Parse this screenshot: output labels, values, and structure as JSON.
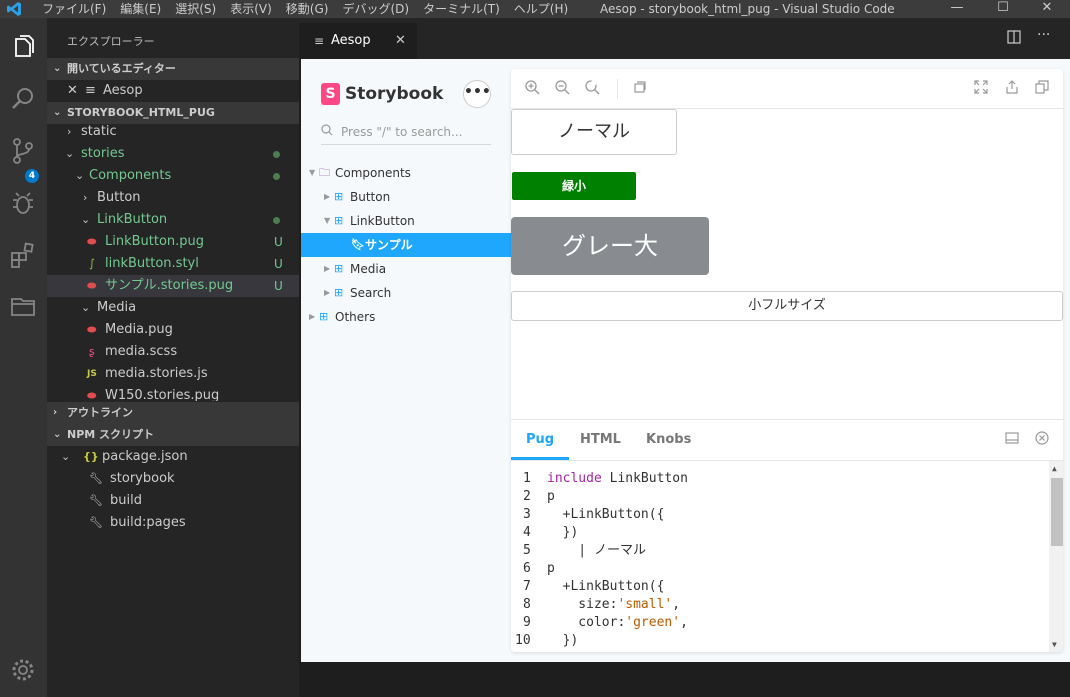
{
  "titlebar": {
    "menus": [
      "ファイル(F)",
      "編集(E)",
      "選択(S)",
      "表示(V)",
      "移動(G)",
      "デバッグ(D)",
      "ターミナル(T)",
      "ヘルプ(H)"
    ],
    "title": "Aesop - storybook_html_pug - Visual Studio Code",
    "minimize": "—",
    "maximize": "☐",
    "close": "✕"
  },
  "activity": {
    "icons": [
      "explorer-icon",
      "search-icon",
      "source-control-icon",
      "debug-icon",
      "extensions-icon",
      "remote-explorer-icon",
      "settings-gear-icon"
    ],
    "scm_badge": "4"
  },
  "sidebar": {
    "title": "エクスプローラー",
    "open_editors": {
      "header": "開いているエディター",
      "items": [
        {
          "close": "✕",
          "icon": "≡",
          "label": "Aesop"
        }
      ]
    },
    "project": {
      "header": "STORYBOOK_HTML_PUG",
      "tree": [
        {
          "arrow": "›",
          "label": "static"
        },
        {
          "arrow": "⌄",
          "label": "stories"
        },
        {
          "arrow": "⌄",
          "label": "Components"
        },
        {
          "arrow": "›",
          "label": "Button"
        },
        {
          "arrow": "⌄",
          "label": "LinkButton"
        },
        {
          "icon": "pug",
          "label": "LinkButton.pug",
          "status": "U"
        },
        {
          "icon": "styl",
          "label": "linkButton.styl",
          "status": "U"
        },
        {
          "icon": "pug",
          "label": "サンプル.stories.pug",
          "status": "U"
        },
        {
          "arrow": "⌄",
          "label": "Media"
        },
        {
          "icon": "pug",
          "label": "Media.pug"
        },
        {
          "icon": "scss",
          "label": "media.scss"
        },
        {
          "icon": "JS",
          "label": "media.stories.js"
        },
        {
          "icon": "pug",
          "label": "W150.stories.pug"
        }
      ]
    },
    "outline": {
      "header": "アウトライン"
    },
    "npm": {
      "header": "NPM スクリプト",
      "package": "package.json",
      "scripts": [
        "storybook",
        "build",
        "build:pages"
      ]
    }
  },
  "editor": {
    "tab": {
      "icon": "≡",
      "label": "Aesop",
      "close": "✕"
    },
    "actions": [
      "split-editor-icon",
      "more-actions-icon"
    ]
  },
  "storybook": {
    "brand": "Storybook",
    "logo_letter": "S",
    "menu": "•••",
    "search_placeholder": "Press \"/\" to search...",
    "nav": [
      {
        "label": "Components",
        "kind": "folder"
      },
      {
        "label": "Button",
        "kind": "component"
      },
      {
        "label": "LinkButton",
        "kind": "component"
      },
      {
        "label": "サンプル",
        "kind": "story",
        "active": true
      },
      {
        "label": "Media",
        "kind": "component"
      },
      {
        "label": "Search",
        "kind": "component"
      },
      {
        "label": "Others",
        "kind": "component"
      }
    ],
    "toolbar": [
      "zoom-in-icon",
      "zoom-out-icon",
      "zoom-reset-icon",
      "background-icon",
      "fullscreen-icon",
      "share-icon",
      "copy-icon"
    ],
    "preview": {
      "normal": "ノーマル",
      "green_small": "緑小",
      "gray_large": "グレー大",
      "full_small": "小フルサイズ"
    },
    "addons": {
      "tabs": [
        "Pug",
        "HTML",
        "Knobs"
      ],
      "active_tab": "Pug",
      "code": [
        {
          "n": "1",
          "text": "include LinkButton"
        },
        {
          "n": "2",
          "text": "p"
        },
        {
          "n": "3",
          "text": "  +LinkButton({"
        },
        {
          "n": "4",
          "text": "  })"
        },
        {
          "n": "5",
          "text": "    | ノーマル"
        },
        {
          "n": "6",
          "text": "p"
        },
        {
          "n": "7",
          "text": "  +LinkButton({"
        },
        {
          "n": "8",
          "text": "    size:'small',"
        },
        {
          "n": "9",
          "text": "    color:'green',"
        },
        {
          "n": "10",
          "text": "  })"
        }
      ]
    }
  },
  "colors": {
    "accent": "#1ea7fd",
    "brand": "#ff4785",
    "green_button": "#008000",
    "gray_button": "#888c91",
    "git_untracked": "#73c991"
  }
}
